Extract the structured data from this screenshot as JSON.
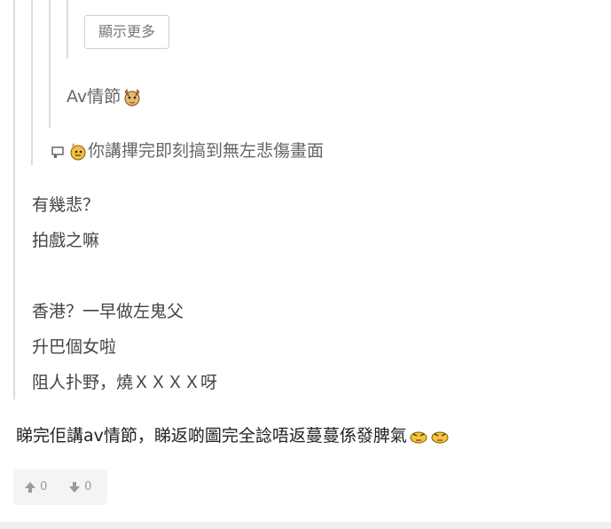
{
  "show_more_label": "顯示更多",
  "quotes": {
    "level3": "Av情節",
    "level2": "你講𢳂完即刻搞到無左悲傷畫面",
    "level1_lines": [
      "有幾悲？",
      "拍戲之嘛",
      "",
      "香港？一早做左鬼父",
      "升巴個女啦",
      "阻人扑野，燒ＸＸＸＸ呀"
    ]
  },
  "reply": {
    "text": "睇完佢講av情節，睇返啲圖完全諗唔返蔓蔓係發脾氣"
  },
  "votes": {
    "up_count": "0",
    "down_count": "0"
  },
  "icons": [
    "dog-emoji-icon",
    "tiger-emoji-icon",
    "angry-emoji-icon",
    "thumbs-up-icon",
    "thumbs-down-icon",
    "thread-icon"
  ]
}
